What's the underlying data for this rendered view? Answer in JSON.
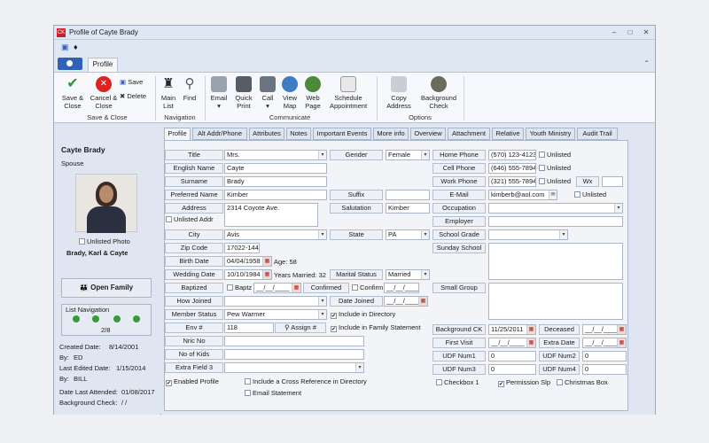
{
  "window": {
    "title": "Profile of Cayte Brady",
    "app_icon": "CK"
  },
  "ribbon_tab": "Profile",
  "ribbon": {
    "save_close": "Save & Close",
    "cancel_close": "Cancel & Close",
    "save": "Save",
    "delete": "Delete",
    "group_save": "Save & Close",
    "main_list": "Main List",
    "find": "Find",
    "group_navigation": "Navigation",
    "email": "Email",
    "quick_print": "Quick Print",
    "call": "Call",
    "view_map": "View Map",
    "web_page": "Web Page",
    "schedule": "Schedule Appointment",
    "group_communicate": "Communicate",
    "copy_address": "Copy Address",
    "background_check": "Background Check",
    "group_options": "Options"
  },
  "sidebar": {
    "name": "Cayte Brady",
    "role": "Spouse",
    "unlisted_photo": "Unlisted Photo",
    "family_name": "Brady, Karl & Cayte",
    "open_family": "Open Family",
    "list_navigation": "List Navigation",
    "nav_position": "2/8",
    "created_date_label": "Created Date:",
    "created_date": "8/14/2001",
    "created_by_label": "By:",
    "created_by": "ED",
    "last_edited_label": "Last Edited Date:",
    "last_edited": "1/15/2014",
    "edited_by_label": "By:",
    "edited_by": "BILL",
    "date_attended_label": "Date Last Attended:",
    "date_attended": "01/08/2017",
    "background_check_label": "Background Check:",
    "background_check": "/ /"
  },
  "tabs": [
    "Profile",
    "Alt Addr/Phone",
    "Attributes",
    "Notes",
    "Important Events",
    "More info",
    "Overview",
    "Attachment",
    "Relative",
    "Youth Ministry",
    "Audit Trail"
  ],
  "form": {
    "title_label": "Title",
    "title": "Mrs.",
    "english_name_label": "English Name",
    "english_name": "Cayte",
    "surname_label": "Surname",
    "surname": "Brady",
    "preferred_name_label": "Preferred Name",
    "preferred_name": "Kimber",
    "address_label": "Address",
    "address": "2314 Coyote Ave.",
    "unlisted_addr": "Unlisted Addr",
    "city_label": "City",
    "city": "Avis",
    "zip_label": "Zip Code",
    "zip": "17022-1442",
    "birth_date_label": "Birth Date",
    "birth_date": "04/04/1958",
    "age": "Age: 58",
    "wedding_date_label": "Wedding Date",
    "wedding_date": "10/10/1984",
    "years_married": "Years Married: 32",
    "baptized_label": "Baptized",
    "baptized_chk": "Baptz",
    "baptized_date": "__/__/____",
    "confirmed_label": "Confirmed",
    "confirmed_chk": "Confirm",
    "confirmed_date": "__/__/____",
    "how_joined_label": "How Joined",
    "date_joined_label": "Date Joined",
    "date_joined": "__/__/____",
    "member_status_label": "Member Status",
    "member_status": "Pew Warmer",
    "include_directory": "Include in Directory",
    "include_family": "Include in Family Statement",
    "env_label": "Env #",
    "env": "118",
    "assign": "Assign #",
    "nric_label": "Nric No",
    "kids_label": "No of Kids",
    "extra3_label": "Extra Field 3",
    "enabled_profile": "Enabled Profile",
    "cross_ref": "Include a Cross Reference in Directory",
    "email_statement": "Email Statement",
    "gender_label": "Gender",
    "gender": "Female",
    "suffix_label": "Suffix",
    "salutation_label": "Salutation",
    "salutation": "Kimber",
    "state_label": "State",
    "state": "PA",
    "marital_label": "Marital Status",
    "marital": "Married",
    "home_phone_label": "Home Phone",
    "home_phone": "(570) 123-4123",
    "home_unlisted": "Unlisted",
    "cell_phone_label": "Cell Phone",
    "cell_phone": "(646) 555-7894",
    "cell_unlisted": "Unlisted",
    "work_phone_label": "Work Phone",
    "work_phone": "(321) 555-7894",
    "work_unlisted": "Unlisted",
    "wx_label": "Wx",
    "email_label": "E-Mail",
    "email": "kimberb@aol.com",
    "email_unlisted": "Unlisted",
    "occupation_label": "Occupation",
    "employer_label": "Employer",
    "school_grade_label": "School Grade",
    "sunday_school_label": "Sunday School",
    "small_group_label": "Small Group",
    "background_ck_label": "Background CK",
    "background_ck": "11/25/2011",
    "deceased_label": "Deceased",
    "deceased": "__/__/____",
    "first_visit_label": "First Visit",
    "first_visit": "__/__/____",
    "extra_date_label": "Extra Date",
    "extra_date": "__/__/____",
    "udf1_label": "UDF Num1",
    "udf1": "0",
    "udf2_label": "UDF Num2",
    "udf2": "0",
    "udf3_label": "UDF Num3",
    "udf3": "0",
    "udf4_label": "UDF Num4",
    "udf4": "0",
    "checkbox1": "Checkbox 1",
    "permission_slip": "Permission Slp",
    "christmas_box": "Christmas Box"
  },
  "colors": {
    "accent": "#2f62b4",
    "panel": "#f2f4f8",
    "window": "#dfe6f1"
  }
}
